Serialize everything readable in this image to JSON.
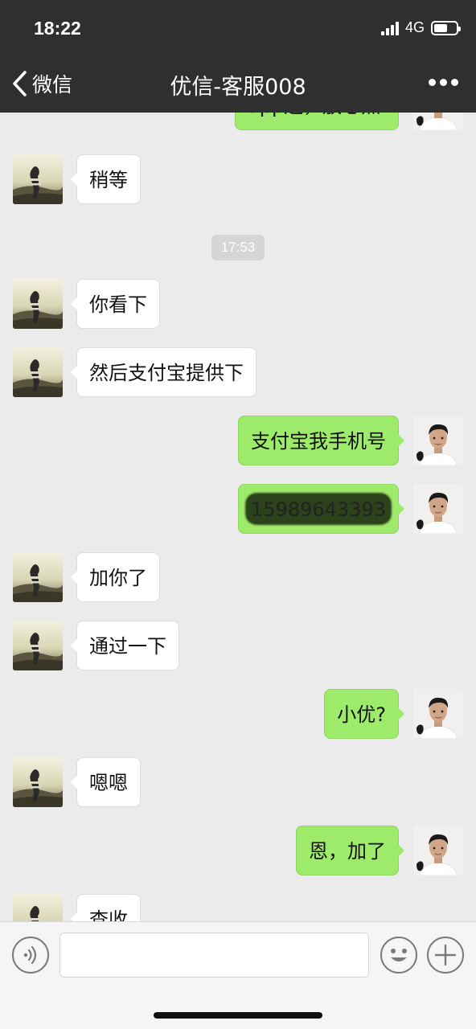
{
  "status_bar": {
    "time": "18:22",
    "network": "4G",
    "battery_level": 0.6
  },
  "nav": {
    "back_label": "微信",
    "title": "优信-客服008"
  },
  "messages": [
    {
      "side": "right",
      "text": "app连，放心点",
      "partial": true
    },
    {
      "side": "left",
      "text": "稍等"
    },
    {
      "timestamp": "17:53"
    },
    {
      "side": "left",
      "text": "你看下"
    },
    {
      "side": "left",
      "text": "然后支付宝提供下"
    },
    {
      "side": "right",
      "text": "支付宝我手机号"
    },
    {
      "side": "right",
      "text": "15989643393",
      "redacted": true
    },
    {
      "side": "left",
      "text": "加你了"
    },
    {
      "side": "left",
      "text": "通过一下"
    },
    {
      "side": "right",
      "text": "小优?"
    },
    {
      "side": "left",
      "text": "嗯嗯"
    },
    {
      "side": "right",
      "text": "恩，加了"
    },
    {
      "side": "left",
      "text": "查收",
      "partial": true
    }
  ],
  "input_bar": {
    "placeholder": "",
    "icons": [
      "voice-icon",
      "emoji-icon",
      "plus-icon"
    ]
  },
  "colors": {
    "header_bg": "#2f2f2f",
    "chat_bg": "#ebebeb",
    "sent_bubble": "#9eea6a",
    "received_bubble": "#ffffff"
  }
}
